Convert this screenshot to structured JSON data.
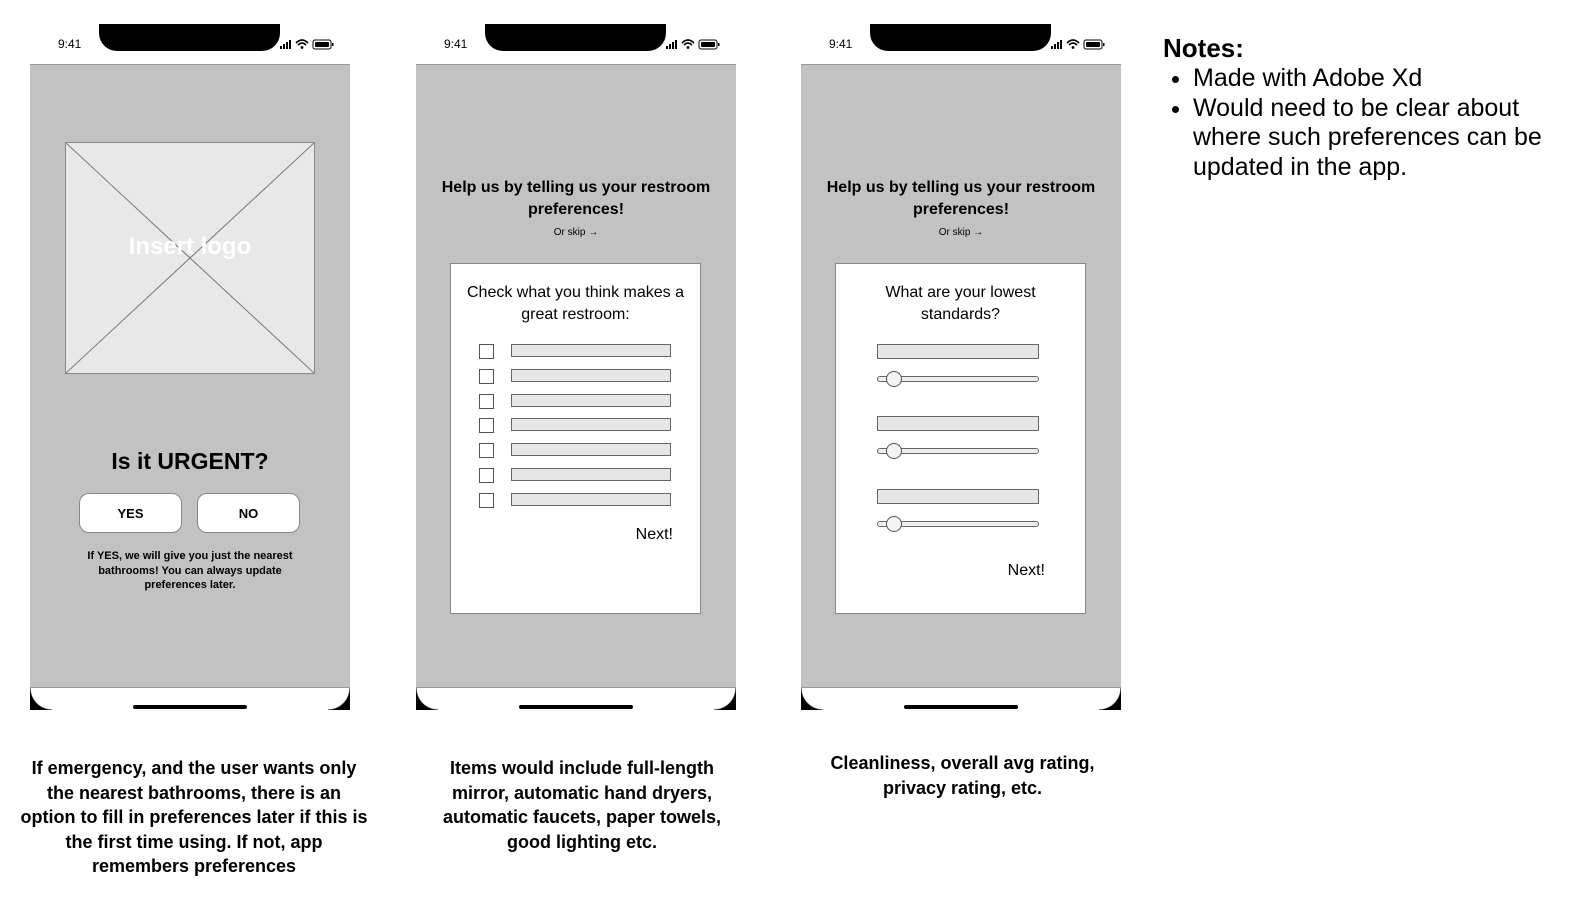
{
  "status_time": "9:41",
  "screen1": {
    "logo_placeholder": "Insert logo",
    "title": "Is it URGENT?",
    "yes_label": "YES",
    "no_label": "NO",
    "fine_text": "If YES, we will give you just the nearest bathrooms! You can always update preferences later."
  },
  "screen2": {
    "heading": "Help us by telling us your restroom preferences!",
    "skip": "Or skip →",
    "card_title": "Check what you think makes a great restroom:",
    "items_count": 7,
    "next": "Next!"
  },
  "screen3": {
    "heading": "Help us by telling us your restroom preferences!",
    "skip": "Or skip →",
    "card_title": "What are your lowest standards?",
    "sliders_count": 3,
    "next": "Next!"
  },
  "captions": {
    "screen1": "If emergency, and the user wants only the nearest bathrooms, there is an option to fill in preferences later if this is the first time using. If not, app remembers preferences",
    "screen2": "Items would include full-length mirror, automatic hand dryers, automatic faucets, paper towels, good lighting etc.",
    "screen3": "Cleanliness, overall avg rating, privacy rating, etc."
  },
  "notes": {
    "title": "Notes:",
    "items": [
      "Made with Adobe Xd",
      "Would need to be clear about where such preferences can be updated in the app."
    ]
  },
  "icons": [
    "signal-icon",
    "wifi-icon",
    "battery-icon"
  ]
}
